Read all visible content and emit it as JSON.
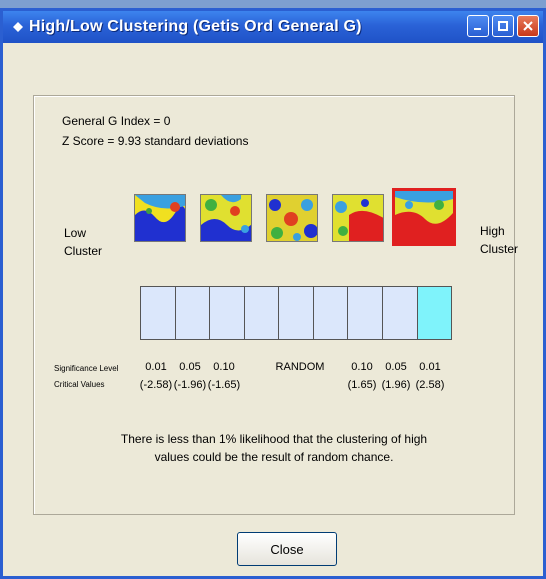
{
  "window": {
    "title": "High/Low Clustering (Getis Ord General G)"
  },
  "results": {
    "general_g": "General G Index = 0",
    "z_score": "Z Score = 9.93 standard deviations"
  },
  "labels": {
    "low": "Low\nCluster",
    "high": "High\nCluster",
    "significance": "Significance Level",
    "critical": "Critical Values"
  },
  "scale": {
    "top_values": [
      "0.01",
      "0.05",
      "0.10",
      "RANDOM",
      "0.10",
      "0.05",
      "0.01"
    ],
    "bottom_values": [
      "(-2.58)",
      "(-1.96)",
      "(-1.65)",
      "",
      "(1.65)",
      "(1.96)",
      "(2.58)"
    ],
    "active_cell": 9
  },
  "message": "There is less than 1% likelihood that the clustering of high values could be the result of random chance.",
  "buttons": {
    "close": "Close"
  },
  "colors": {
    "active_cell": "#7ff3fb",
    "selected_border": "#e02020",
    "cell": "#dbe7fb"
  }
}
